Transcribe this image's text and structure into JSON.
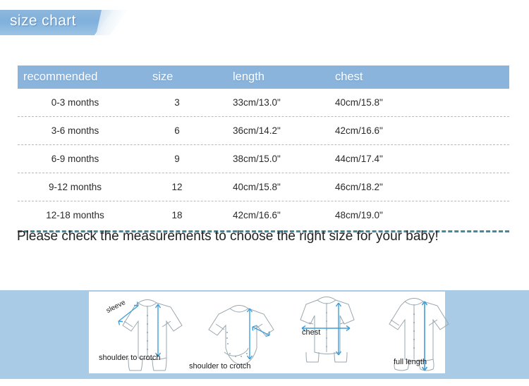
{
  "banner": {
    "title": "size chart",
    "bg_color": "#8ab4dc"
  },
  "table": {
    "headers": {
      "recommended": "recommended",
      "size": "size",
      "length": "length",
      "chest": "chest"
    },
    "header_bg": "#8ab4dc",
    "separator_color": "#8fb9cf",
    "bottom_rule_color": "#3f8a9b",
    "rows": [
      {
        "recommended": "0-3 months",
        "size": "3",
        "length": "33cm/13.0\"",
        "chest": "40cm/15.8\""
      },
      {
        "recommended": "3-6 months",
        "size": "6",
        "length": "36cm/14.2\"",
        "chest": "42cm/16.6\""
      },
      {
        "recommended": "6-9 months",
        "size": "9",
        "length": "38cm/15.0\"",
        "chest": "44cm/17.4\""
      },
      {
        "recommended": "9-12 months",
        "size": "12",
        "length": "40cm/15.8\"",
        "chest": "46cm/18.2\""
      },
      {
        "recommended": "12-18 months",
        "size": "18",
        "length": "42cm/16.6\"",
        "chest": "48cm/19.0\""
      }
    ]
  },
  "note": {
    "text": "Please check the measurements to choose the right size for your baby!"
  },
  "illustrations": {
    "band_color": "#a9cbe6",
    "arrow_color": "#3f9fd8",
    "outline_color": "#9aa7ae",
    "items": [
      {
        "garment": "long-sleeve-romper",
        "label": "shoulder to crotch",
        "extra_label": "sleeve"
      },
      {
        "garment": "bodysuit",
        "label": "shoulder to crotch",
        "extra_label": ""
      },
      {
        "garment": "short-sleeve-romper",
        "label": "chest",
        "extra_label": ""
      },
      {
        "garment": "footed-romper",
        "label": "full length",
        "extra_label": ""
      }
    ]
  }
}
